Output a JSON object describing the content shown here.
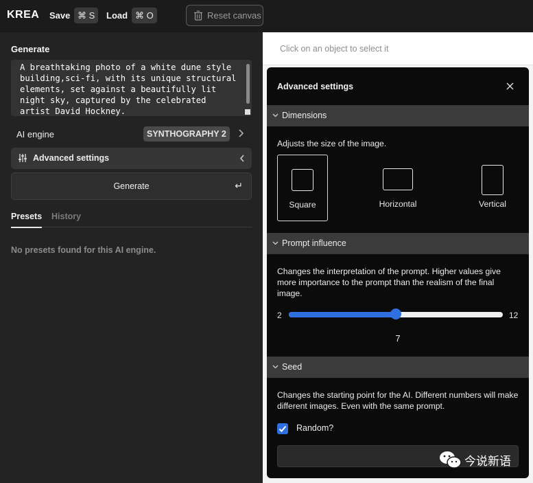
{
  "topbar": {
    "logo": "KREA",
    "save_label": "Save",
    "save_shortcut": "⌘ S",
    "load_label": "Load",
    "load_shortcut": "⌘ O",
    "reset_label": "Reset canvas"
  },
  "left": {
    "section_title": "Generate",
    "prompt_text": "A breathtaking photo of a white dune style building,sci-fi, with its unique structural elements, set against a beautifully lit night sky, captured by the celebrated artist David Hockney.",
    "engine_label": "AI engine",
    "engine_value": "SYNTHOGRAPHY 2",
    "advanced_label": "Advanced settings",
    "generate_label": "Generate",
    "generate_key": "↵",
    "tabs": [
      "Presets",
      "History"
    ],
    "empty_message": "No presets found for this AI engine."
  },
  "canvas": {
    "hint": "Click on an object to select it"
  },
  "panel": {
    "title": "Advanced settings",
    "dimensions": {
      "title": "Dimensions",
      "description": "Adjusts the size of the image.",
      "options": [
        "Square",
        "Horizontal",
        "Vertical"
      ],
      "selected": "Square"
    },
    "prompt_influence": {
      "title": "Prompt influence",
      "description": "Changes the interpretation of the prompt. Higher values give more importance to the prompt than the realism of the final image.",
      "min": "2",
      "max": "12",
      "value": "7",
      "fraction": 0.5
    },
    "seed": {
      "title": "Seed",
      "description": "Changes the starting point for the AI. Different numbers will make different images. Even with the same prompt.",
      "random_label": "Random?",
      "random_checked": true
    }
  },
  "watermark": {
    "text": "今说新语"
  },
  "colors": {
    "accent": "#2f6fe0",
    "panel_bg": "#0b0b0b",
    "section_bg": "#3b3b3b"
  }
}
